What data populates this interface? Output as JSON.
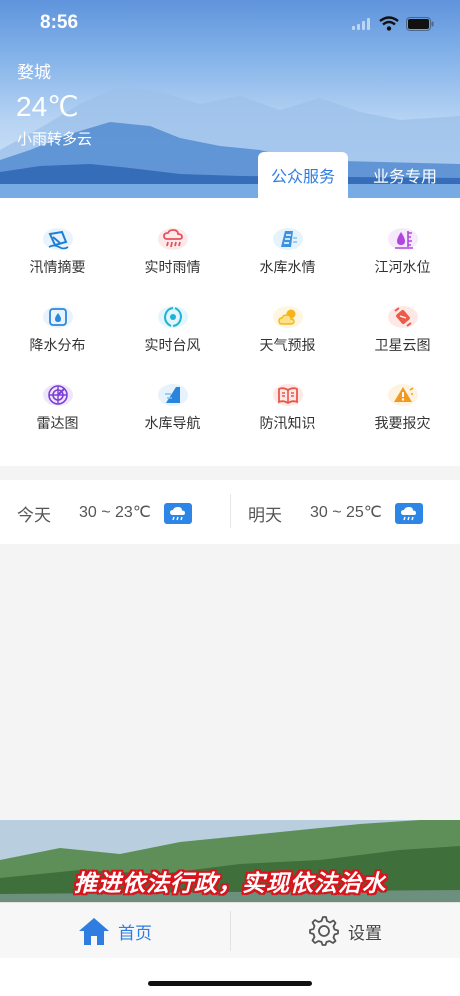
{
  "status_bar": {
    "time": "8:56",
    "icons": [
      "signal-icon",
      "wifi-icon",
      "battery-icon"
    ]
  },
  "weather": {
    "city": "婺城",
    "temperature": "24℃",
    "description": "小雨转多云"
  },
  "tabs": [
    {
      "label": "公众服务",
      "active": true
    },
    {
      "label": "业务专用",
      "active": false
    }
  ],
  "services": [
    {
      "label": "汛情摘要",
      "icon": "flood-summary-icon"
    },
    {
      "label": "实时雨情",
      "icon": "rain-cloud-icon"
    },
    {
      "label": "水库水情",
      "icon": "reservoir-icon"
    },
    {
      "label": "江河水位",
      "icon": "water-level-icon"
    },
    {
      "label": "降水分布",
      "icon": "precipitation-map-icon"
    },
    {
      "label": "实时台风",
      "icon": "typhoon-icon"
    },
    {
      "label": "天气预报",
      "icon": "sun-cloud-icon"
    },
    {
      "label": "卫星云图",
      "icon": "satellite-icon"
    },
    {
      "label": "雷达图",
      "icon": "radar-icon"
    },
    {
      "label": "水库导航",
      "icon": "navigation-icon"
    },
    {
      "label": "防汛知识",
      "icon": "book-icon"
    },
    {
      "label": "我要报灾",
      "icon": "warning-icon"
    }
  ],
  "forecast": {
    "today": {
      "label": "今天",
      "range": "30 ~ 23℃",
      "icon": "rain-icon"
    },
    "tomorrow": {
      "label": "明天",
      "range": "30 ~ 25℃",
      "icon": "rain-icon"
    }
  },
  "banner": {
    "text": "推进依法行政，实现依法治水"
  },
  "tabbar": [
    {
      "label": "首页",
      "icon": "home-icon",
      "color": "#2f7de1"
    },
    {
      "label": "设置",
      "icon": "gear-icon",
      "color": "#444444"
    }
  ],
  "colors": {
    "accent": "#2f7de1",
    "badge": "#2d86e6",
    "banner_text_stroke": "#d8141c"
  }
}
